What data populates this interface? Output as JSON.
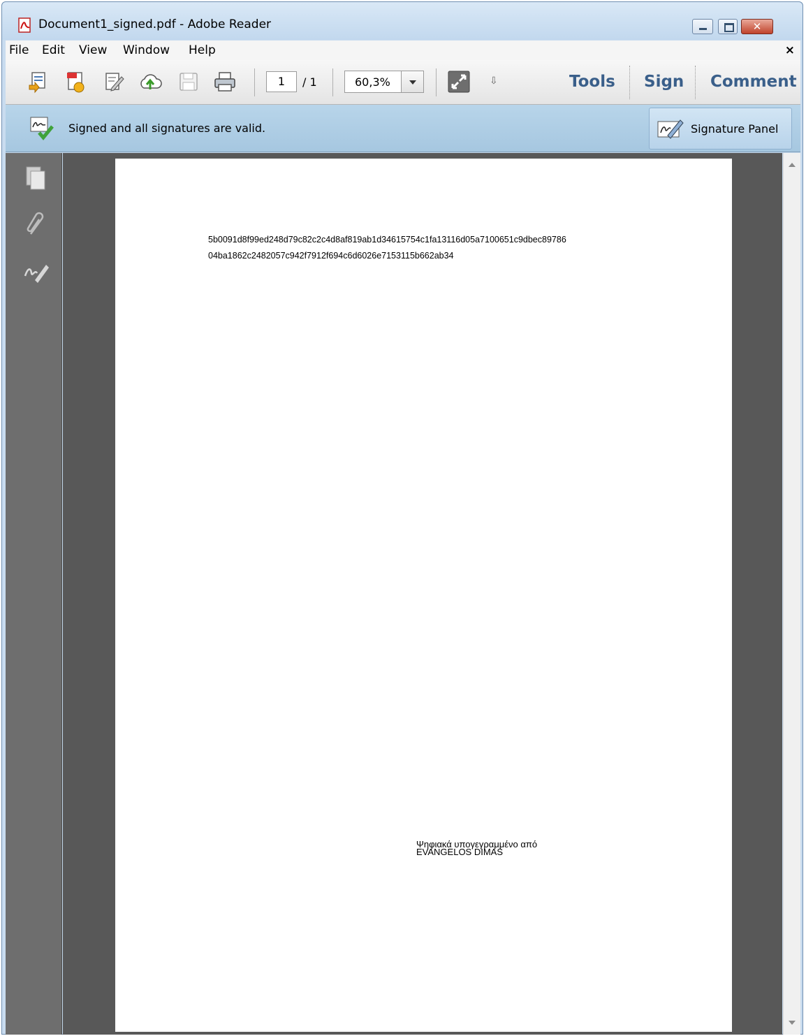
{
  "window": {
    "title": "Document1_signed.pdf - Adobe Reader",
    "close_symbol": "✕"
  },
  "menubar": {
    "items": [
      "File",
      "Edit",
      "View",
      "Window",
      "Help"
    ],
    "close_symbol": "×"
  },
  "toolbar": {
    "icons": [
      "open-icon",
      "create-pdf-icon",
      "edit-icon",
      "upload-cloud-icon",
      "save-icon",
      "print-icon"
    ],
    "page_current": "1",
    "page_total": "/ 1",
    "zoom": "60,3%",
    "more_symbol": "⇩",
    "panes": [
      "Tools",
      "Sign",
      "Comment"
    ]
  },
  "signature_bar": {
    "message": "Signed and all signatures are valid.",
    "panel_button": "Signature Panel"
  },
  "document": {
    "hash_line_1": "5b0091d8f99ed248d79c82c2c4d8af819ab1d34615754c1fa13116d05a7100651c9dbec89786",
    "hash_line_2": "04ba1862c2482057c942f7912f694c6d6026e7153115b662ab34",
    "signature_line_1": "Ψηφιακά υπογεγραμμένο από",
    "signature_line_2": "EVANGELOS DIMAS"
  },
  "colors": {
    "pane_label": "#3a5f8a",
    "signature_bar": "#b8d5ea",
    "workarea": "#585858"
  }
}
